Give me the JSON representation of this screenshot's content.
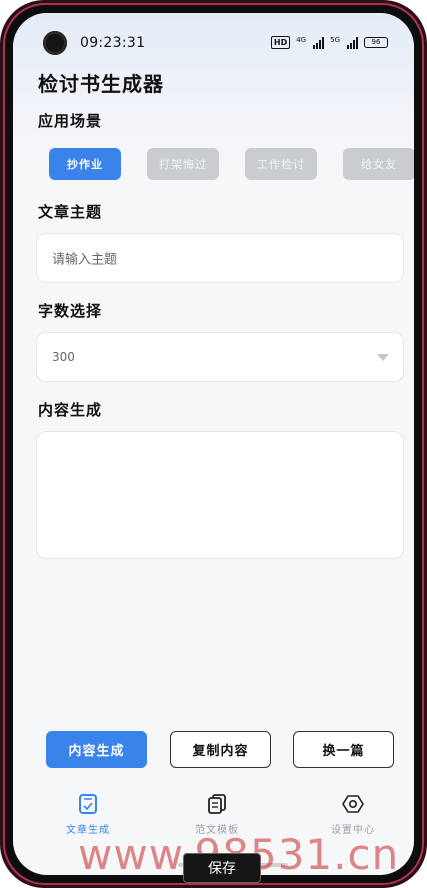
{
  "status_bar": {
    "time": "09:23:31",
    "hd": "HD",
    "net1": "4G",
    "net2": "5G",
    "battery": "96"
  },
  "app": {
    "title": "检讨书生成器"
  },
  "scene": {
    "label": "应用场景",
    "chips": [
      {
        "label": "抄作业",
        "active": true
      },
      {
        "label": "打架悔过",
        "active": false
      },
      {
        "label": "工作检讨",
        "active": false
      },
      {
        "label": "给女友",
        "active": false
      }
    ]
  },
  "topic": {
    "label": "文章主题",
    "placeholder": "请输入主题"
  },
  "wordcount": {
    "label": "字数选择",
    "value": "300"
  },
  "content": {
    "label": "内容生成",
    "value": ""
  },
  "actions": {
    "generate": "内容生成",
    "copy": "复制内容",
    "regenerate": "换一篇"
  },
  "tabbar": {
    "items": [
      {
        "label": "文章生成",
        "icon": "document-check-icon",
        "active": true
      },
      {
        "label": "范文模板",
        "icon": "copy-icon",
        "active": false
      },
      {
        "label": "设置中心",
        "icon": "settings-hex-icon",
        "active": false
      }
    ]
  },
  "overlay": {
    "watermark": "www.98531.cn",
    "save_button": "保存"
  },
  "colors": {
    "accent": "#3a83ea",
    "chip_inactive": "#c9ccd1",
    "frame": "#b0324a",
    "watermark": "#c82828"
  }
}
